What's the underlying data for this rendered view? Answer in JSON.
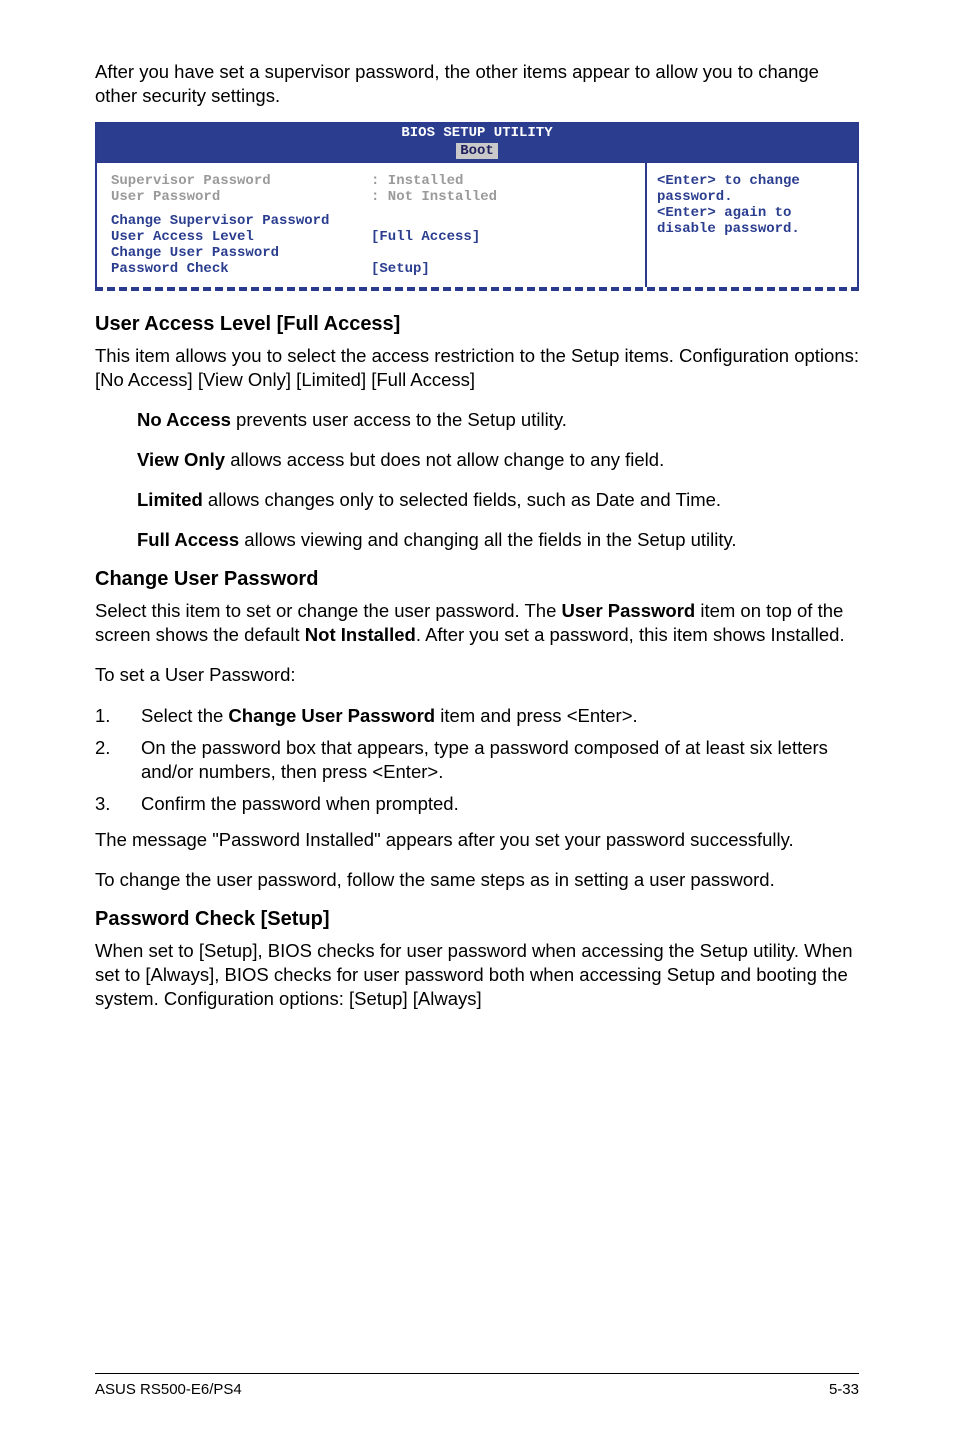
{
  "intro": "After you have set a supervisor password, the other items appear to allow you to change other security settings.",
  "bios": {
    "title": "BIOS SETUP UTILITY",
    "tab": "Boot",
    "left": {
      "supervisor_label": "Supervisor Password",
      "supervisor_value": ": Installed",
      "user_label": "User Password",
      "user_value": ": Not Installed",
      "change_supervisor": "Change Supervisor Password",
      "access_level_label": "User Access Level",
      "access_level_value": "[Full Access]",
      "change_user": "Change User Password",
      "pw_check_label": "Password Check",
      "pw_check_value": "[Setup]"
    },
    "right": {
      "l1": "<Enter> to change",
      "l2": "password.",
      "l3": "<Enter> again to",
      "l4": "disable password."
    }
  },
  "section_ual": {
    "heading": "User Access Level [Full Access]",
    "p": "This item allows you to select the access restriction to the Setup items. Configuration options: [No Access] [View Only] [Limited] [Full Access]",
    "opts": {
      "no_access_b": "No Access",
      "no_access_t": " prevents user access to the Setup utility.",
      "view_only_b": "View Only",
      "view_only_t": " allows access but does not allow change to any field.",
      "limited_b": "Limited",
      "limited_t": " allows changes only to selected fields, such as Date and Time.",
      "full_access_b": "Full Access",
      "full_access_t": " allows viewing and changing all the fields in the Setup utility."
    }
  },
  "section_cup": {
    "heading": "Change User Password",
    "p_pre": "Select this item to set or change the user password. The ",
    "p_b1": "User Password",
    "p_mid": " item on top of the screen shows the default ",
    "p_b2": "Not Installed",
    "p_post": ". After you set a password, this item shows Installed.",
    "to_set": "To set a User Password:",
    "steps": {
      "s1_pre": "Select the ",
      "s1_b": "Change User Password",
      "s1_post": " item and press <Enter>.",
      "s2": "On the password box that appears, type a password composed of at least six letters and/or numbers, then press <Enter>.",
      "s3": "Confirm the password when prompted."
    },
    "p_after": "The message \"Password Installed\" appears after you set your password successfully.",
    "p_change": "To change the user password, follow the same steps as in setting a user password."
  },
  "section_pc": {
    "heading": "Password Check [Setup]",
    "p": "When set to [Setup], BIOS checks for user password when accessing the Setup utility. When set to [Always], BIOS checks for user password both when accessing Setup and booting the system. Configuration options: [Setup] [Always]"
  },
  "footer": {
    "left": "ASUS RS500-E6/PS4",
    "right": "5-33"
  }
}
